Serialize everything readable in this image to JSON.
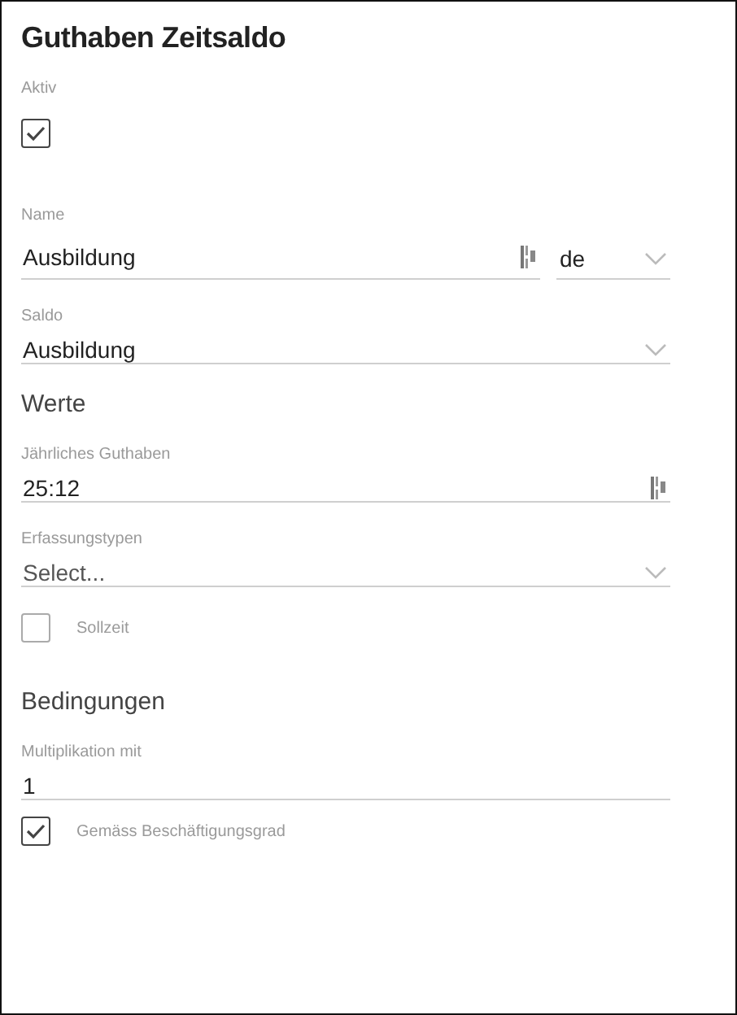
{
  "title": "Guthaben Zeitsaldo",
  "fields": [
    {
      "kind": "checkbox",
      "label": "Aktiv",
      "checked": true
    },
    {
      "kind": "translatable",
      "label": "Name",
      "value": "Ausbildung",
      "language": "de"
    },
    {
      "kind": "select",
      "label": "Saldo",
      "value": "Ausbildung"
    },
    {
      "kind": "heading",
      "label": "Werte"
    },
    {
      "kind": "text",
      "label": "Jährliches Guthaben",
      "value": "25:12",
      "icon": true
    },
    {
      "kind": "select",
      "label": "Erfassungstypen",
      "placeholder": "Select..."
    },
    {
      "kind": "inline_checkbox",
      "label": "Sollzeit",
      "checked": false
    },
    {
      "kind": "heading",
      "label": "Bedingungen"
    },
    {
      "kind": "text",
      "label": "Multiplikation mit",
      "value": "1",
      "icon": false
    },
    {
      "kind": "inline_checkbox",
      "label": "Gemäss Beschäftigungsgrad",
      "checked": true
    }
  ]
}
